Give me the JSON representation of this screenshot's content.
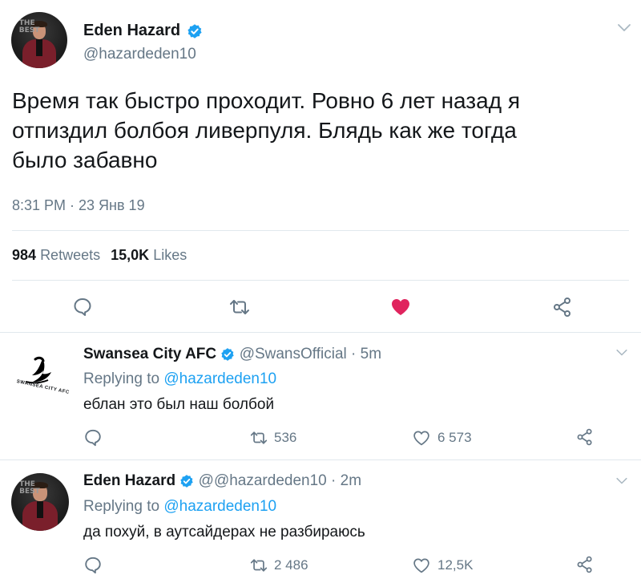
{
  "main_tweet": {
    "author_name": "Eden Hazard",
    "handle": "@hazardeden10",
    "avatar_text": "THE\nBEST",
    "text_line1": "Время так быстро проходит. Ровно 6 лет назад я",
    "text_line2": "отпиздил болбоя ливерпуля. Блядь как же тогда",
    "text_line3": "было забавно",
    "timestamp": "8:31 PM · 23 Янв 19",
    "retweets_count": "984",
    "retweets_label": "Retweets",
    "likes_count": "15,0K",
    "likes_label": "Likes"
  },
  "replies": [
    {
      "author_name": "Swansea City AFC",
      "handle": "@SwansOfficial",
      "time": "· 5m",
      "replying_prefix": "Replying to",
      "replying_to": "@hazardeden10",
      "text": "еблан это был наш болбой",
      "retweets": "536",
      "likes": "6 573",
      "avatar_text": "SWANSEA CITY AFC"
    },
    {
      "author_name": "Eden Hazard",
      "handle": "@@hazardeden10",
      "time": "· 2m",
      "replying_prefix": "Replying to",
      "replying_to": "@hazardeden10",
      "text": "да похуй, в аутсайдерах не разбираюсь",
      "retweets": "2 486",
      "likes": "12,5K",
      "avatar_text": "THE\nBEST"
    }
  ],
  "colors": {
    "accent": "#1da1f2",
    "like_red": "#e0245e",
    "text": "#14171a",
    "secondary": "#657786",
    "divider": "#e1e8ed"
  },
  "icons": [
    "verified-badge-icon",
    "chevron-down-icon",
    "reply-icon",
    "retweet-icon",
    "heart-icon",
    "share-icon"
  ]
}
